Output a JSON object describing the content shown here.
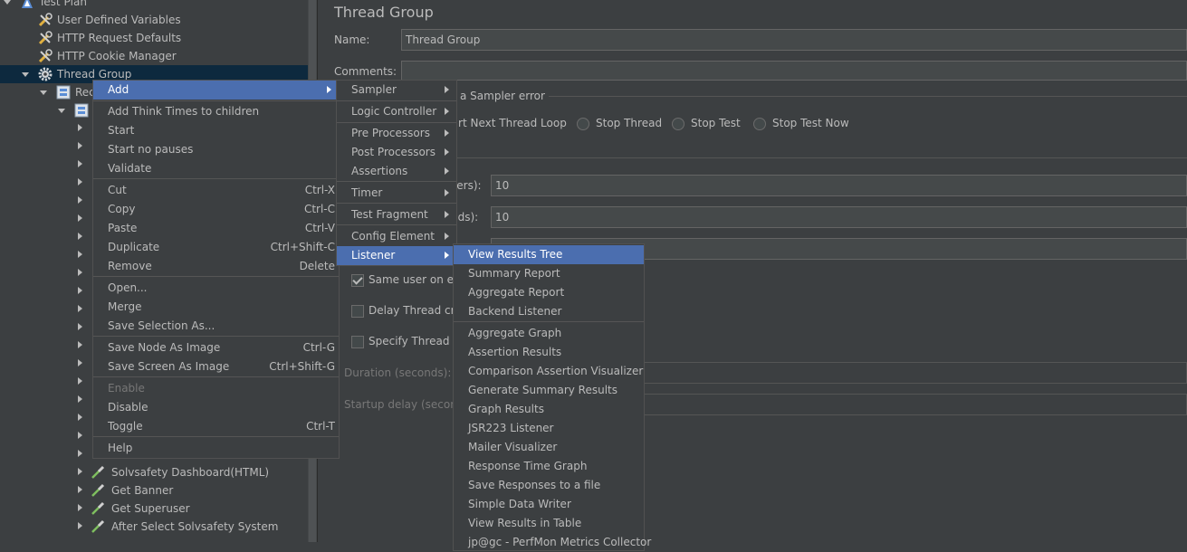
{
  "tree": {
    "items": [
      {
        "label": "Test Plan",
        "icon": "test-plan-icon",
        "depth": 0,
        "toggle": "down"
      },
      {
        "label": "User Defined Variables",
        "icon": "wrench-icon",
        "depth": 1,
        "toggle": "none"
      },
      {
        "label": "HTTP Request Defaults",
        "icon": "wrench-icon",
        "depth": 1,
        "toggle": "none"
      },
      {
        "label": "HTTP Cookie Manager",
        "icon": "wrench-icon",
        "depth": 1,
        "toggle": "none"
      },
      {
        "label": "Thread Group",
        "icon": "gear-icon",
        "depth": 1,
        "toggle": "down",
        "selected": true
      },
      {
        "label": "Rec",
        "icon": "controller-icon",
        "depth": 2,
        "toggle": "down"
      },
      {
        "label": "",
        "icon": "controller-icon",
        "depth": 3,
        "toggle": "down"
      }
    ],
    "bottom_items": [
      {
        "label": "Solvsafety Dashboard(HTML)",
        "icon": "pipette-icon"
      },
      {
        "label": "Get Banner",
        "icon": "pipette-icon"
      },
      {
        "label": "Get Superuser",
        "icon": "pipette-icon"
      },
      {
        "label": "After Select Solvsafety System",
        "icon": "pipette-icon"
      }
    ]
  },
  "panel": {
    "title": "Thread Group",
    "name_label": "Name:",
    "name_value": "Thread Group",
    "comments_label": "Comments:",
    "sampler_error_label": "a Sampler error",
    "radio_options": [
      "tart Next Thread Loop",
      "Stop Thread",
      "Stop Test",
      "Stop Test Now"
    ],
    "users_label": "sers):",
    "users_value": "10",
    "rampup_label": "nds):",
    "rampup_value": "10",
    "same_user_label": "Same user on ea",
    "delay_label": "Delay Thread cre",
    "specify_label": "Specify Thread lif",
    "duration_label": "Duration (seconds):",
    "startup_label": "Startup delay (second"
  },
  "context_menu": {
    "groups": [
      [
        {
          "label": "Add",
          "submenu": true,
          "highlighted": true
        }
      ],
      [
        {
          "label": "Add Think Times to children"
        },
        {
          "label": "Start"
        },
        {
          "label": "Start no pauses"
        },
        {
          "label": "Validate"
        }
      ],
      [
        {
          "label": "Cut",
          "shortcut": "Ctrl-X"
        },
        {
          "label": "Copy",
          "shortcut": "Ctrl-C"
        },
        {
          "label": "Paste",
          "shortcut": "Ctrl-V"
        },
        {
          "label": "Duplicate",
          "shortcut": "Ctrl+Shift-C"
        },
        {
          "label": "Remove",
          "shortcut": "Delete"
        }
      ],
      [
        {
          "label": "Open..."
        },
        {
          "label": "Merge"
        },
        {
          "label": "Save Selection As..."
        }
      ],
      [
        {
          "label": "Save Node As Image",
          "shortcut": "Ctrl-G"
        },
        {
          "label": "Save Screen As Image",
          "shortcut": "Ctrl+Shift-G"
        }
      ],
      [
        {
          "label": "Enable",
          "disabled": true
        },
        {
          "label": "Disable"
        },
        {
          "label": "Toggle",
          "shortcut": "Ctrl-T"
        }
      ],
      [
        {
          "label": "Help"
        }
      ]
    ]
  },
  "add_menu": {
    "groups": [
      [
        {
          "label": "Sampler",
          "submenu": true
        }
      ],
      [
        {
          "label": "Logic Controller",
          "submenu": true
        }
      ],
      [
        {
          "label": "Pre Processors",
          "submenu": true
        },
        {
          "label": "Post Processors",
          "submenu": true
        },
        {
          "label": "Assertions",
          "submenu": true
        }
      ],
      [
        {
          "label": "Timer",
          "submenu": true
        }
      ],
      [
        {
          "label": "Test Fragment",
          "submenu": true
        }
      ],
      [
        {
          "label": "Config Element",
          "submenu": true
        },
        {
          "label": "Listener",
          "submenu": true,
          "highlighted": true
        }
      ]
    ]
  },
  "listener_menu": {
    "groups": [
      [
        {
          "label": "View Results Tree",
          "highlighted": true
        },
        {
          "label": "Summary Report"
        },
        {
          "label": "Aggregate Report"
        },
        {
          "label": "Backend Listener"
        }
      ],
      [
        {
          "label": "Aggregate Graph"
        },
        {
          "label": "Assertion Results"
        },
        {
          "label": "Comparison Assertion Visualizer"
        },
        {
          "label": "Generate Summary Results"
        },
        {
          "label": "Graph Results"
        },
        {
          "label": "JSR223 Listener"
        },
        {
          "label": "Mailer Visualizer"
        },
        {
          "label": "Response Time Graph"
        },
        {
          "label": "Save Responses to a file"
        },
        {
          "label": "Simple Data Writer"
        },
        {
          "label": "View Results in Table"
        },
        {
          "label": "jp@gc - PerfMon Metrics Collector"
        }
      ]
    ]
  },
  "colors": {
    "background": "#3c3f41",
    "highlight": "#4b6eaf",
    "selection": "#0d293e",
    "text": "#bbbbbb"
  }
}
